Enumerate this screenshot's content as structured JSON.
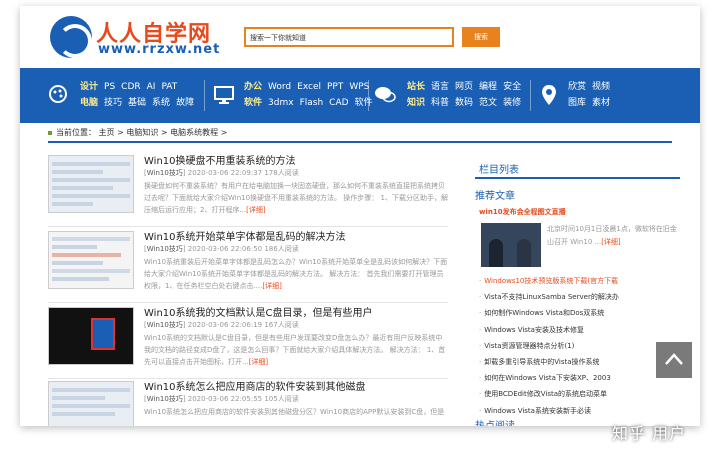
{
  "header": {
    "logo_title": "人人自学网",
    "logo_url": "www.rrzxw.net",
    "search_placeholder": "搜索一下你就知道",
    "search_button": "搜索"
  },
  "nav": {
    "group1": {
      "row1": [
        "设计",
        "PS",
        "CDR",
        "AI",
        "PAT"
      ],
      "row2": [
        "电脑",
        "技巧",
        "基础",
        "系统",
        "故障"
      ]
    },
    "group2": {
      "row1": [
        "办公",
        "Word",
        "Excel",
        "PPT",
        "WPS"
      ],
      "row2": [
        "软件",
        "3dmx",
        "Flash",
        "CAD",
        "软件"
      ]
    },
    "group3": {
      "row1": [
        "站长",
        "语言",
        "网页",
        "编程",
        "安全"
      ],
      "row2": [
        "知识",
        "科普",
        "数码",
        "范文",
        "装修"
      ]
    },
    "group4": {
      "row1": [
        "欣赏",
        "视频"
      ],
      "row2": [
        "图库",
        "素材"
      ]
    }
  },
  "breadcrumb": {
    "label": "当前位置：",
    "items": [
      "主页",
      "电脑知识",
      "电脑系统教程"
    ],
    "sep": " > "
  },
  "articles": [
    {
      "title": "Win10换硬盘不用重装系统的方法",
      "category": "Win10技巧",
      "meta": "2020-03-06 22:09:37 178人阅读",
      "desc": "换硬盘如何不重装系统？有用户在给电脑加换一块固态硬盘，那么如何不重装系统直接把系统拷贝过去呢？下面就给大家介绍Win10换硬盘不用重装系统的方法。 操作步骤： 1、下载分区助手，解压缩后运行应用；2、打开程序...",
      "more": "[详细]"
    },
    {
      "title": "Win10系统开始菜单字体都是乱码的解决方法",
      "category": "Win10技巧",
      "meta": "2020-03-06 22:06:50 186人阅读",
      "desc": "Win10系统重装后开始菜单字体都是乱码怎么办？Win10系统开始菜单全是乱码该如何解决？下面给大家介绍Win10系统开始菜单字体都是乱码的解决方法。 解决方法： 首先我们需要打开管理员权限，1、在任务栏空白处右键点击....",
      "more": "[详细]"
    },
    {
      "title": "Win10系统我的文档默认是C盘目录，但是有些用户",
      "category": "Win10技巧",
      "meta": "2020-03-06 22:06:19 167人阅读",
      "desc": "Win10系统的文档默认是C盘目录，但是有些用户发现要改变D盘怎么办？最近有用户反映系统中我的文档的路径变成D盘了，这是怎么回事？下面就给大家介绍具体解决方法。 解决方法： 1、首先可以直接点击开始图标，打开...",
      "more": "[详细]"
    },
    {
      "title": "Win10系统怎么把应用商店的软件安装到其他磁盘",
      "category": "Win10技巧",
      "meta": "2020-03-06 22:05:55 105人阅读",
      "desc": "Win10系统怎么把应用商店的软件安装到其他磁盘分区？Win10商店的APP默认安装到C盘，但是",
      "more": ""
    }
  ],
  "sidebar": {
    "heading": "栏目列表",
    "recommend": "推荐文章",
    "featured_title": "win10发布会全程图文直播",
    "featured_desc": "北京时间10月1日凌晨1点，微软将在旧金山召开 Win10 ...",
    "featured_more": "[详细]",
    "items": [
      {
        "text": "Windows10技术预览版系统下载(官方下载",
        "hot": true
      },
      {
        "text": "Vista不支持LinuxSamba Server的解决办",
        "hot": false
      },
      {
        "text": "如何制作Windows Vista和Dos双系统",
        "hot": false
      },
      {
        "text": "Windows Vista安装及技术修复",
        "hot": false
      },
      {
        "text": "Vista资源管理器特点分析(1)",
        "hot": false
      },
      {
        "text": "卸载多重引导系统中的Vista操作系统",
        "hot": false
      },
      {
        "text": "如何在Windows Vista下安装XP、2003",
        "hot": false
      },
      {
        "text": "使用BCDEdit修改Vista的系统启动菜单",
        "hot": false
      },
      {
        "text": "Windows Vista系统安装新手必读",
        "hot": false
      }
    ],
    "hot_heading": "热点阅读"
  },
  "watermark": "知乎 用户",
  "colors": {
    "brand_blue": "#1a5fb4",
    "accent_orange": "#e8821d",
    "hot_red": "#e8491d"
  }
}
